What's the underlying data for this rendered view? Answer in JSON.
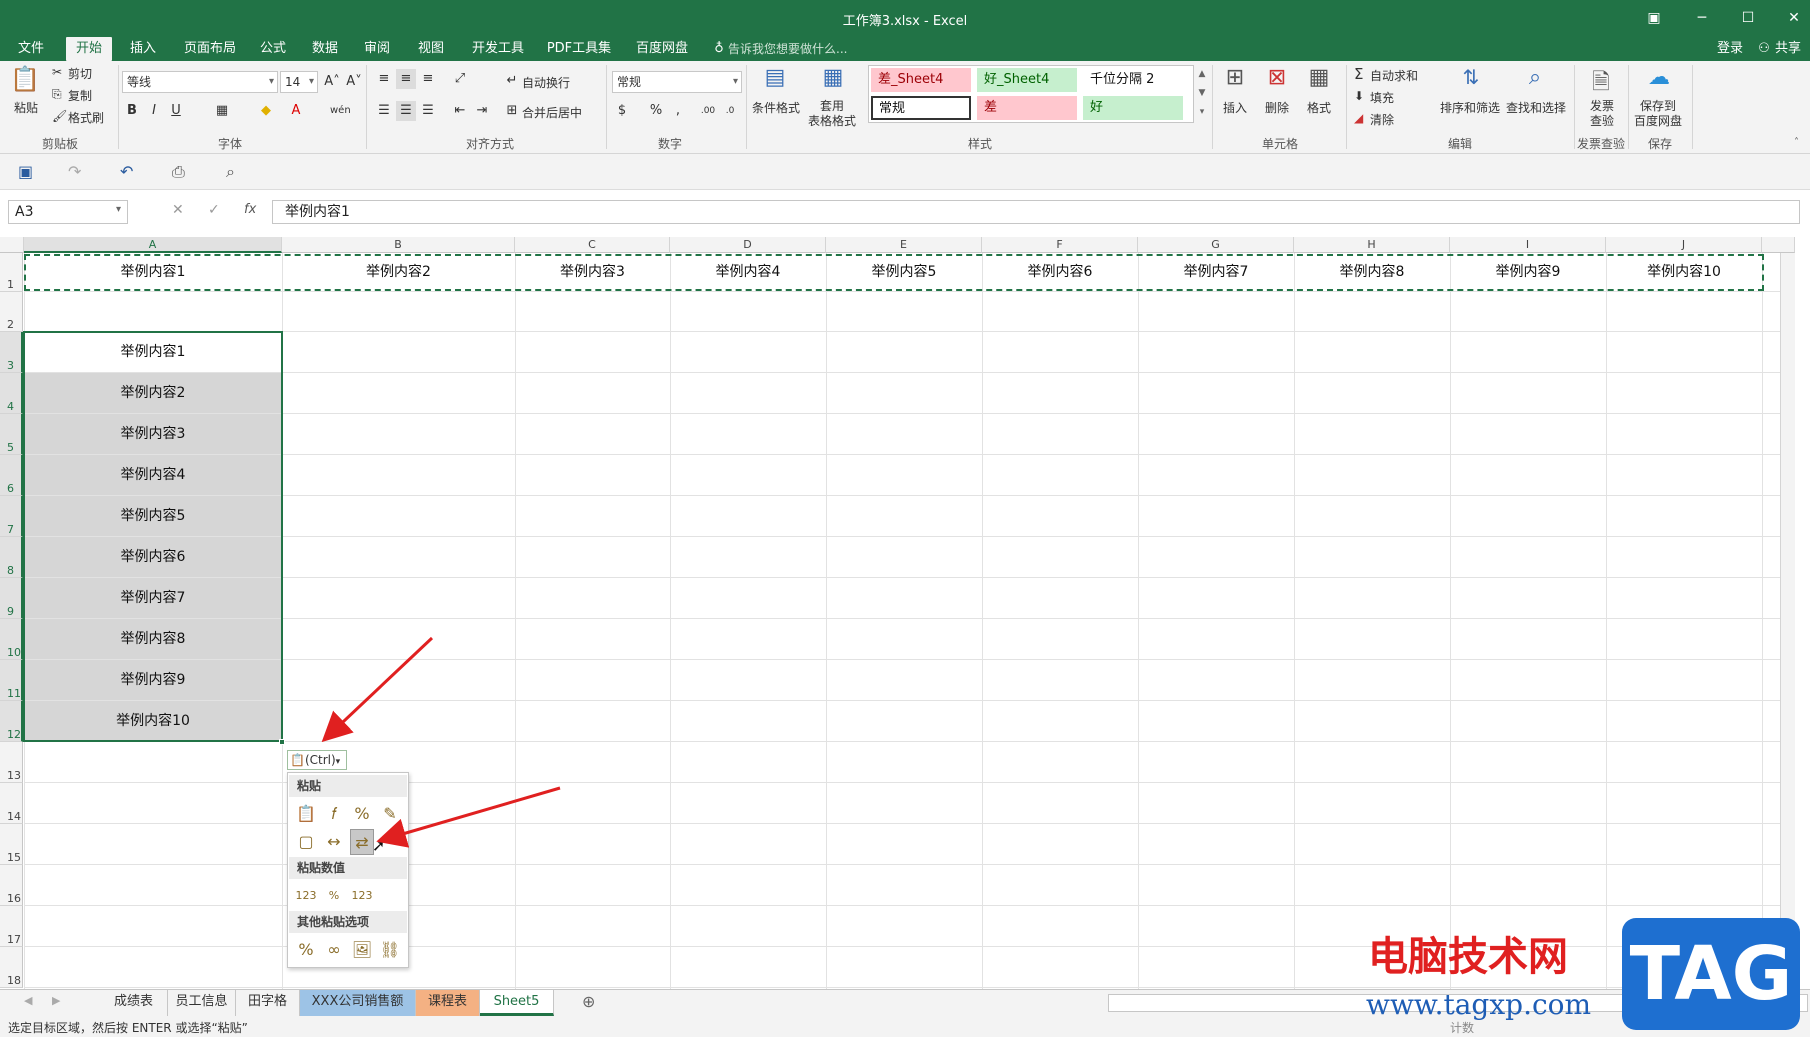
{
  "window": {
    "title": "工作簿3.xlsx - Excel"
  },
  "menu": {
    "tabs": [
      "文件",
      "开始",
      "插入",
      "页面布局",
      "公式",
      "数据",
      "审阅",
      "视图",
      "开发工具",
      "PDF工具集",
      "百度网盘"
    ],
    "active": "开始",
    "tell_me": "告诉我您想要做什么...",
    "login": "登录",
    "share": "共享"
  },
  "ribbon": {
    "clipboard": {
      "paste": "粘贴",
      "cut": "剪切",
      "copy": "复制",
      "format_painter": "格式刷",
      "label": "剪贴板"
    },
    "font": {
      "name": "等线",
      "size": "14",
      "label": "字体",
      "bold": "B",
      "italic": "I",
      "underline": "U"
    },
    "alignment": {
      "wrap": "自动换行",
      "merge": "合并后居中",
      "label": "对齐方式"
    },
    "number": {
      "format": "常规",
      "percent": "%",
      "comma": ",",
      "label": "数字"
    },
    "styles": {
      "conditional": "条件格式",
      "table": "套用\n表格格式",
      "cells": [
        "差_Sheet4",
        "好_Sheet4",
        "千位分隔 2",
        "常规",
        "差",
        "好"
      ],
      "label": "样式"
    },
    "cells": {
      "insert": "插入",
      "delete": "删除",
      "format": "格式",
      "label": "单元格"
    },
    "editing": {
      "autosum": "自动求和",
      "fill": "填充",
      "clear": "清除",
      "sort": "排序和筛选",
      "find": "查找和选择",
      "label": "编辑"
    },
    "invoice": {
      "check": "发票\n查验",
      "label": "发票查验"
    },
    "save": {
      "baidu": "保存到\n百度网盘",
      "label": "保存"
    }
  },
  "formula_bar": {
    "name_box": "A3",
    "fx": "fx",
    "content": "举例内容1"
  },
  "columns": [
    "A",
    "B",
    "C",
    "D",
    "E",
    "F",
    "G",
    "H",
    "I",
    "J"
  ],
  "rows": [
    "1",
    "2",
    "3",
    "4",
    "5",
    "6",
    "7",
    "8",
    "9",
    "10",
    "11",
    "12",
    "13",
    "14",
    "15",
    "16",
    "17",
    "18"
  ],
  "row1": [
    "举例内容1",
    "举例内容2",
    "举例内容3",
    "举例内容4",
    "举例内容5",
    "举例内容6",
    "举例内容7",
    "举例内容8",
    "举例内容9",
    "举例内容10"
  ],
  "colA": [
    "举例内容1",
    "举例内容2",
    "举例内容3",
    "举例内容4",
    "举例内容5",
    "举例内容6",
    "举例内容7",
    "举例内容8",
    "举例内容9",
    "举例内容10"
  ],
  "paste_options": {
    "ctrl": "(Ctrl)",
    "section1": "粘贴",
    "section2": "粘贴数值",
    "section3": "其他粘贴选项"
  },
  "sheet_tabs": [
    "成绩表",
    "员工信息",
    "田字格",
    "XXX公司销售额",
    "课程表",
    "Sheet5"
  ],
  "active_sheet": "Sheet5",
  "status": {
    "message": "选定目标区域，然后按 ENTER 或选择“粘贴”",
    "count_label": "计数"
  },
  "watermark": {
    "title": "电脑技术网",
    "url": "www.tagxp.com",
    "tag": "TAG"
  }
}
